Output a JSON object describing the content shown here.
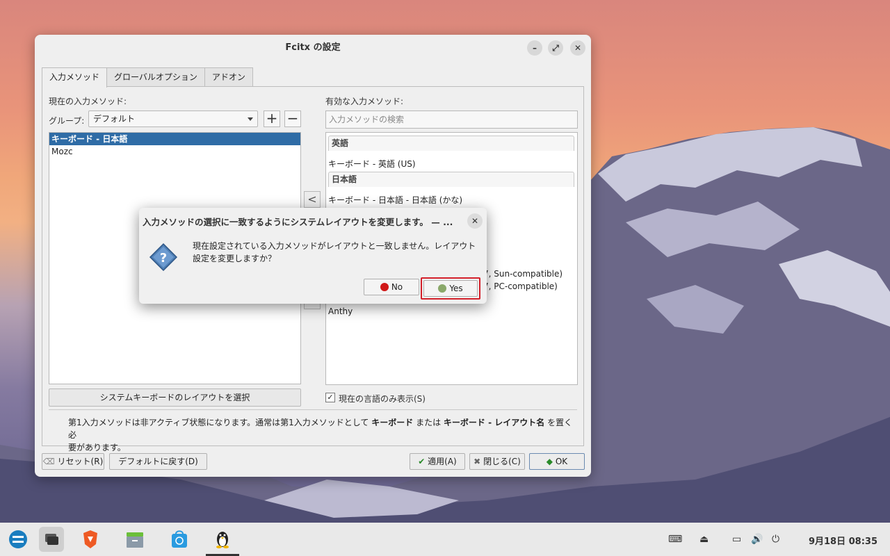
{
  "window": {
    "title": "Fcitx の設定",
    "tabs": [
      "入力メソッド",
      "グローバルオプション",
      "アドオン"
    ],
    "current_label": "現在の入力メソッド:",
    "group_label": "グループ:",
    "group_value": "デフォルト",
    "current_methods": [
      "キーボード - 日本語",
      "Mozc"
    ],
    "select_layout_button": "システムキーボードのレイアウトを選択",
    "available_label": "有効な入力メソッド:",
    "search_placeholder": "入力メソッドの検索",
    "groups": [
      {
        "header": "英語",
        "items": [
          "キーボード - 英語 (US)"
        ]
      },
      {
        "header": "日本語",
        "items": [
          "キーボード - 日本語 - 日本語 (かな)"
        ]
      }
    ],
    "partial_items": [
      "7, Sun-compatible)",
      "7, PC-compatible)",
      "Anthy"
    ],
    "show_current_lang": "現在の言語のみ表示(S)",
    "note_line1_a": "第1入力メソッドは非アクティブ状態になります。通常は第1入力メソッドとして",
    "note_kbd": "キーボード",
    "note_or": "または",
    "note_kbd_layout": "キーボード - レイアウト名",
    "note_line1_b": "を置く必",
    "note_line2": "要があります。",
    "reset": "リセット(R)",
    "defaults": "デフォルトに戻す(D)",
    "apply": "適用(A)",
    "close": "閉じる(C)",
    "ok": "OK"
  },
  "dialog": {
    "title": "入力メソッドの選択に一致するようにシステムレイアウトを変更します。 — ...",
    "message_line1": "現在設定されている入力メソッドがレイアウトと一致しません。レイアウト",
    "message_line2": "設定を変更しますか？",
    "no": "No",
    "yes": "Yes"
  },
  "taskbar": {
    "clock": "9月18日  08:35"
  },
  "colors": {
    "selection": "#2f6ca6",
    "highlight": "#d3202a"
  }
}
